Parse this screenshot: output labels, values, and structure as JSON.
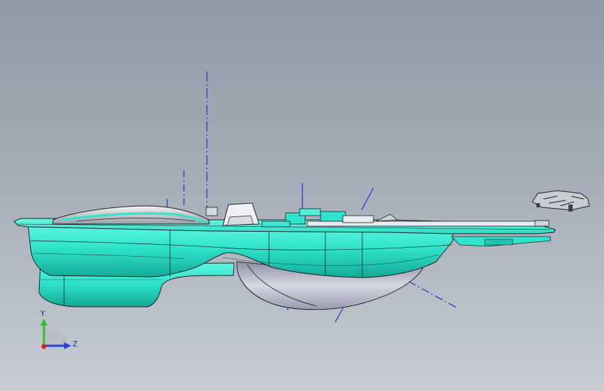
{
  "viewport": {
    "background_top": "#8f9aa6",
    "background_bottom": "#c7ccd2"
  },
  "model": {
    "body_color": "#2fe4cc",
    "body_shadow_color": "#14b3a0",
    "edge_color": "#1a1f24",
    "pod_color": "#b9bcc8",
    "centerline_color": "#1b2fd0"
  },
  "triad": {
    "y_label": "Y",
    "z_label": "Z",
    "y_color": "#2fbf2f",
    "z_color": "#2740d8",
    "origin_color": "#d42020",
    "view_icon": "view-orientation-icon"
  }
}
